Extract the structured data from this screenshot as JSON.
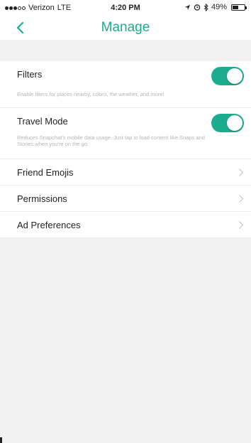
{
  "status_bar": {
    "carrier": "Verizon",
    "network": "LTE",
    "time": "4:20 PM",
    "battery_percent": "49%",
    "battery_level": 0.49,
    "signal_bars_filled": 3,
    "signal_bars_total": 5
  },
  "nav": {
    "title": "Manage"
  },
  "settings": {
    "filters": {
      "label": "Filters",
      "description": "Enable filters for places nearby, colors, the weather, and more!",
      "enabled": true
    },
    "travel_mode": {
      "label": "Travel Mode",
      "description": "Reduces Snapchat's mobile data usage. Just tap to load content like Snaps and Stories when you're on the go.",
      "enabled": true
    },
    "friend_emojis": {
      "label": "Friend Emojis"
    },
    "permissions": {
      "label": "Permissions"
    },
    "ad_preferences": {
      "label": "Ad Preferences"
    }
  },
  "colors": {
    "accent": "#1bac8e",
    "background": "#f2f2f2"
  }
}
